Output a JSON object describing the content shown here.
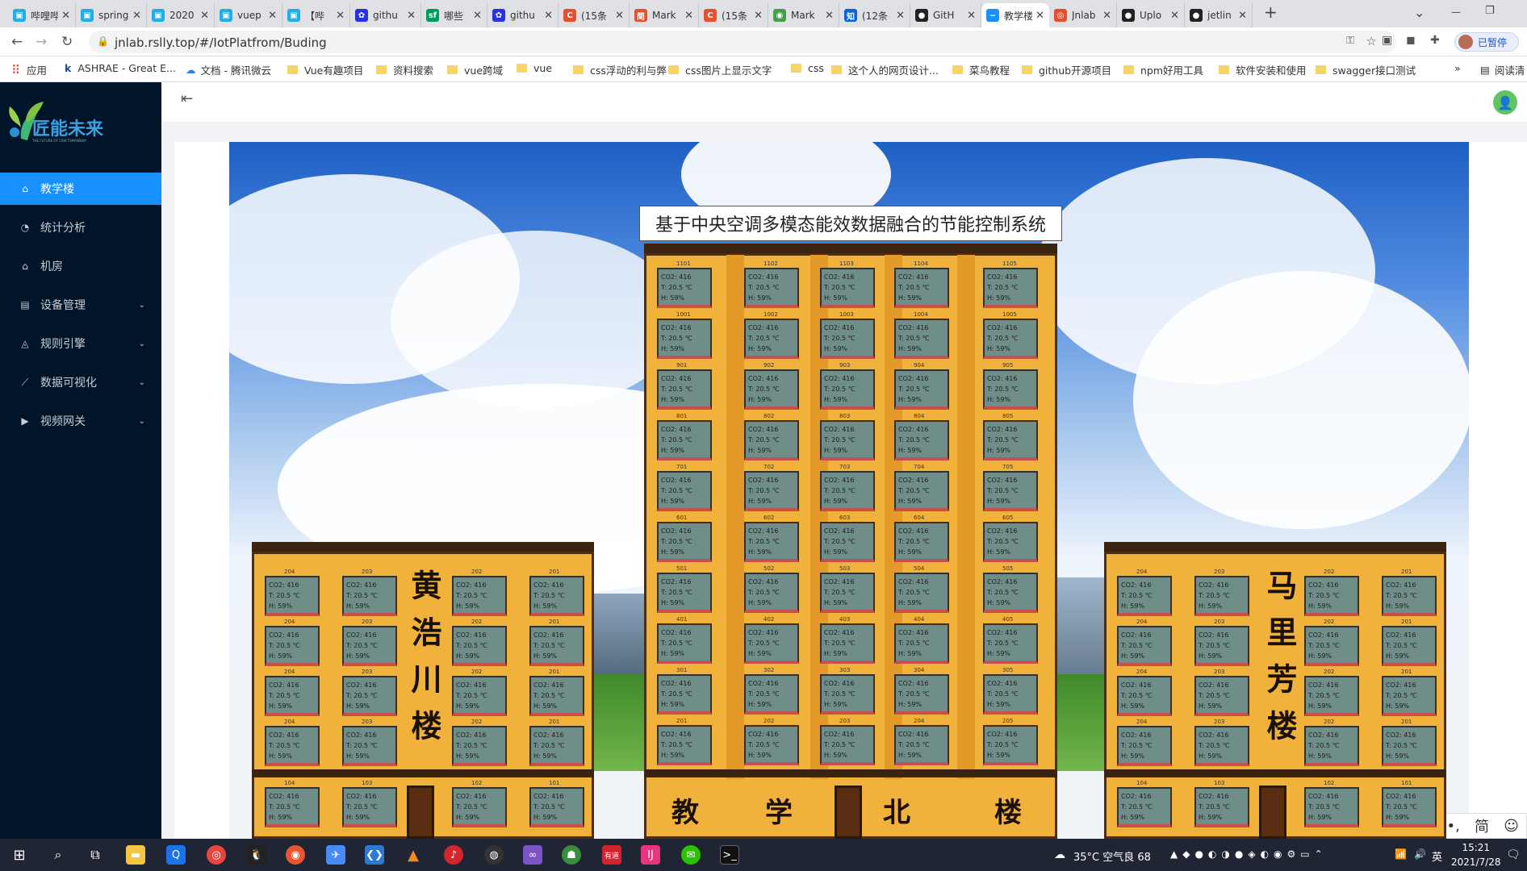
{
  "browser": {
    "tabs": [
      {
        "title": "哔哩哔",
        "color": "#23ade5",
        "glyph": "▣"
      },
      {
        "title": "spring",
        "color": "#23ade5",
        "glyph": "▣"
      },
      {
        "title": "2020",
        "color": "#23ade5",
        "glyph": "▣"
      },
      {
        "title": "vuep",
        "color": "#23ade5",
        "glyph": "▣"
      },
      {
        "title": "【哔",
        "color": "#23ade5",
        "glyph": "▣"
      },
      {
        "title": "githu",
        "color": "#2932e1",
        "glyph": "✿"
      },
      {
        "title": "哪些",
        "color": "#009a61",
        "glyph": "sf"
      },
      {
        "title": "githu",
        "color": "#2932e1",
        "glyph": "✿"
      },
      {
        "title": "(15条",
        "color": "#e5502f",
        "glyph": "C"
      },
      {
        "title": "Mark",
        "color": "#e5502f",
        "glyph": "简"
      },
      {
        "title": "(15条",
        "color": "#e5502f",
        "glyph": "C"
      },
      {
        "title": "Mark",
        "color": "#44a047",
        "glyph": "◉"
      },
      {
        "title": "(12条",
        "color": "#0a66d8",
        "glyph": "知"
      },
      {
        "title": "GitH",
        "color": "#222",
        "glyph": "●"
      },
      {
        "title": "教学楼",
        "color": "#1890ff",
        "glyph": "~"
      },
      {
        "title": "Jnlab",
        "color": "#e5502f",
        "glyph": "◎"
      },
      {
        "title": "Uplo",
        "color": "#222",
        "glyph": "●"
      },
      {
        "title": "jetlin",
        "color": "#222",
        "glyph": "●"
      }
    ],
    "active_tab": 14,
    "new_tab": "+",
    "url": "jnlab.rslly.top/#/IotPlatfrom/Buding",
    "paused_label": "已暂停",
    "bookmarks": [
      {
        "label": "应用",
        "icon": "apps"
      },
      {
        "label": "ASHRAE - Great E...",
        "icon": "k"
      },
      {
        "label": "文档 - 腾讯微云",
        "icon": "cloud"
      },
      {
        "label": "Vue有趣项目",
        "icon": "folder"
      },
      {
        "label": "资料搜索",
        "icon": "folder"
      },
      {
        "label": "vue跨域",
        "icon": "folder"
      },
      {
        "label": "vue",
        "icon": "folder"
      },
      {
        "label": "css浮动的利与弊",
        "icon": "folder"
      },
      {
        "label": "css图片上显示文字",
        "icon": "folder"
      },
      {
        "label": "css",
        "icon": "folder"
      },
      {
        "label": "这个人的网页设计...",
        "icon": "folder"
      },
      {
        "label": "菜鸟教程",
        "icon": "folder"
      },
      {
        "label": "github开源项目",
        "icon": "folder"
      },
      {
        "label": "npm好用工具",
        "icon": "folder"
      },
      {
        "label": "软件安装和使用",
        "icon": "folder"
      },
      {
        "label": "swagger接口测试",
        "icon": "folder"
      }
    ],
    "bookmarks_more": "»",
    "reading_list": "阅读清"
  },
  "app": {
    "logo_text": "匠能未来",
    "logo_sub": "THE FUTURE OF CRAFTSMANSHIP",
    "menu": [
      {
        "label": "教学楼",
        "icon": "⌂",
        "active": true,
        "has_sub": false
      },
      {
        "label": "统计分析",
        "icon": "◔",
        "active": false,
        "has_sub": false
      },
      {
        "label": "机房",
        "icon": "⌂",
        "active": false,
        "has_sub": false
      },
      {
        "label": "设备管理",
        "icon": "▤",
        "active": false,
        "has_sub": true
      },
      {
        "label": "规则引擎",
        "icon": "◬",
        "active": false,
        "has_sub": true
      },
      {
        "label": "数据可视化",
        "icon": "⟋",
        "active": false,
        "has_sub": true
      },
      {
        "label": "视频网关",
        "icon": "▶",
        "active": false,
        "has_sub": true
      }
    ],
    "title": "基于中央空调多模态能效数据融合的节能控制系统",
    "room_reading": {
      "co2": "CO2: 416",
      "temp": "T: 20.5 ℃",
      "hum": "H: 59%"
    },
    "buildings": {
      "north": {
        "name": "教学北楼",
        "chars": [
          "教",
          "学",
          "北",
          "楼"
        ],
        "floors": [
          [
            "1101",
            "1102",
            "1103",
            "1104",
            "1105"
          ],
          [
            "1001",
            "1002",
            "1003",
            "1004",
            "1005"
          ],
          [
            "901",
            "902",
            "903",
            "904",
            "905"
          ],
          [
            "801",
            "802",
            "803",
            "804",
            "805"
          ],
          [
            "701",
            "702",
            "703",
            "704",
            "705"
          ],
          [
            "601",
            "602",
            "603",
            "604",
            "605"
          ],
          [
            "501",
            "502",
            "503",
            "504",
            "505"
          ],
          [
            "401",
            "402",
            "403",
            "404",
            "405"
          ],
          [
            "301",
            "302",
            "303",
            "304",
            "305"
          ],
          [
            "201",
            "202",
            "203",
            "204",
            "205"
          ]
        ]
      },
      "west": {
        "name": "黄浩川楼",
        "chars": [
          "黄",
          "浩",
          "川",
          "楼"
        ],
        "floors": [
          [
            "204",
            "203",
            "202",
            "201"
          ],
          [
            "204",
            "203",
            "202",
            "201"
          ],
          [
            "204",
            "203",
            "202",
            "201"
          ],
          [
            "204",
            "203",
            "202",
            "201"
          ],
          [
            "104",
            "103",
            "102",
            "101"
          ]
        ]
      },
      "east": {
        "name": "马里芳楼",
        "chars": [
          "马",
          "里",
          "芳",
          "楼"
        ],
        "floors": [
          [
            "204",
            "203",
            "202",
            "201"
          ],
          [
            "204",
            "203",
            "202",
            "201"
          ],
          [
            "204",
            "203",
            "202",
            "201"
          ],
          [
            "204",
            "203",
            "202",
            "201"
          ],
          [
            "104",
            "103",
            "102",
            "101"
          ]
        ]
      }
    }
  },
  "ime": [
    "英",
    "☽",
    "•,",
    "简",
    "☺"
  ],
  "taskbar": {
    "weather": "35°C 空气良 68",
    "lang": "英",
    "time": "15:21",
    "date": "2021/7/28"
  }
}
